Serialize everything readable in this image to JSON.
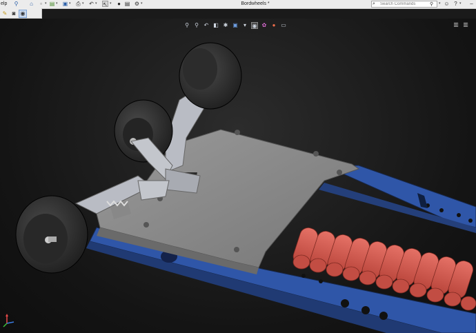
{
  "window": {
    "title": "Bordwheels *",
    "menu_fragment": "elp"
  },
  "search": {
    "placeholder": "Search Commands"
  },
  "icons": {
    "titlebar_left": [
      "pin-icon",
      "home-icon",
      "new-icon",
      "open-icon",
      "save-icon",
      "print-icon",
      "undo-icon",
      "select-icon",
      "traffic-light-icon",
      "options-icon"
    ],
    "titlebar_right": [
      "user-icon",
      "help-icon",
      "minimize-icon"
    ],
    "toolbar2": [
      "sketch-icon",
      "camera-icon",
      "appearance-icon"
    ],
    "heads_up": [
      "zoom-fit-icon",
      "zoom-area-icon",
      "previous-view-icon",
      "section-view-icon",
      "dynamic-annotation-icon",
      "view-orientation-icon",
      "display-style-icon",
      "hide-show-icon",
      "edit-appearance-icon",
      "scene-icon",
      "view-settings-icon"
    ],
    "viewport_controls": [
      "tile-icon",
      "maximize-icon"
    ]
  },
  "colors": {
    "frame": "#2f56a8",
    "deck": "#8d8d8d",
    "battery": "#d9574c",
    "wheel": "#2b2b2b",
    "truck": "#b9bcc4"
  }
}
